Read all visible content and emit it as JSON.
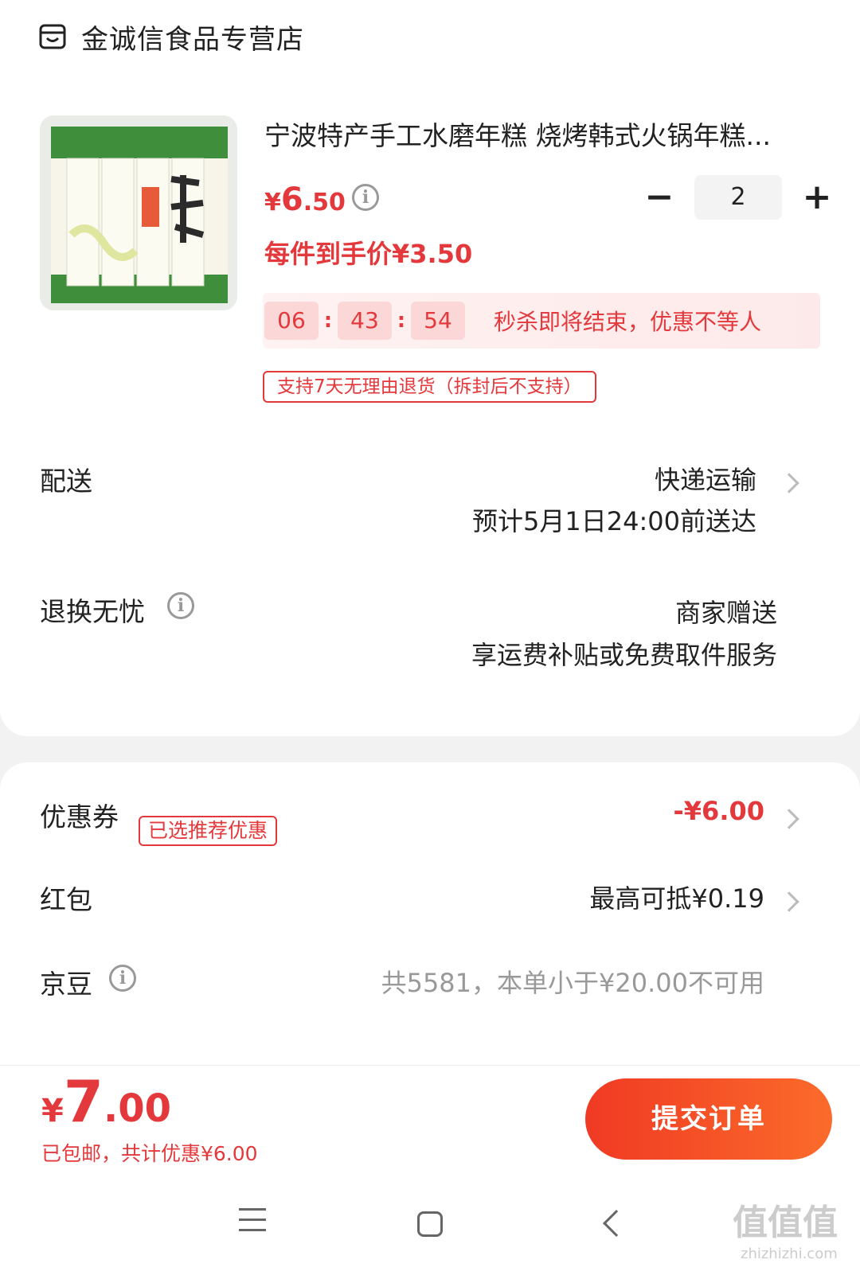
{
  "store": {
    "name": "金诚信食品专营店",
    "icon": "store-icon"
  },
  "product": {
    "title": "宁波特产手工水磨年糕 烧烤韩式火锅年糕...",
    "image_icon": "rice-cake-package-image",
    "price_symbol": "¥",
    "price_int": "6",
    "price_dec": ".50",
    "unit_price": "每件到手价¥3.50",
    "quantity": "2",
    "qty_minus": "−",
    "qty_plus": "+",
    "countdown": {
      "h": "06",
      "m": "43",
      "s": "54",
      "sep": ":",
      "text": "秒杀即将结束，优惠不等人"
    },
    "return_tag": "支持7天无理由退货（拆封后不支持）"
  },
  "delivery": {
    "label": "配送",
    "method": "快递运输",
    "eta": "预计5月1日24:00前送达"
  },
  "returns": {
    "label": "退换无忧",
    "value1": "商家赠送",
    "value2": "享运费补贴或免费取件服务"
  },
  "coupon": {
    "label": "优惠券",
    "tag": "已选推荐优惠",
    "value": "-¥6.00"
  },
  "red_packet": {
    "label": "红包",
    "value": "最高可抵¥0.19"
  },
  "jd_beans": {
    "label": "京豆",
    "value": "共5581，本单小于¥20.00不可用"
  },
  "checkout": {
    "symbol": "¥",
    "int": "7",
    "dec": ".00",
    "sub": "已包邮，共计优惠¥6.00",
    "button": "提交订单"
  },
  "watermark": {
    "main": "值值值",
    "sub": "zhizhizhi.com"
  },
  "colors": {
    "accent": "#e4393c",
    "button_start": "#f03a24",
    "button_end": "#fb6b2a"
  }
}
